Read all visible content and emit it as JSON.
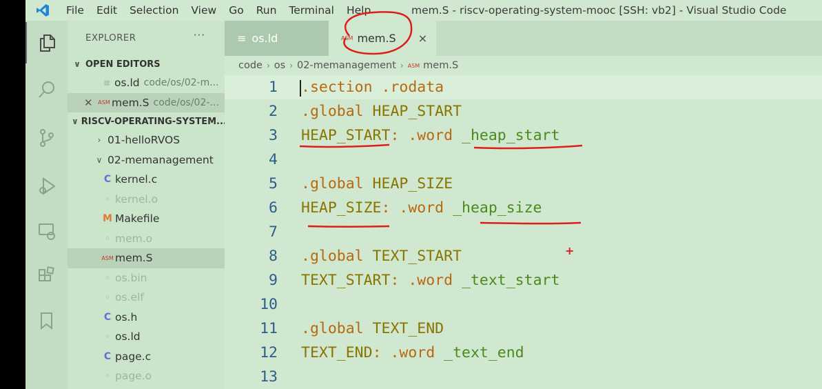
{
  "titlebar": {
    "menu": [
      "File",
      "Edit",
      "Selection",
      "View",
      "Go",
      "Run",
      "Terminal",
      "Help"
    ],
    "window_title": "mem.S - riscv-operating-system-mooc [SSH: vb2] - Visual Studio Code"
  },
  "activitybar": {
    "icons": [
      "explorer-icon",
      "search-icon",
      "source-control-icon",
      "run-debug-icon",
      "remote-explorer-icon",
      "extensions-icon",
      "bookmarks-icon"
    ]
  },
  "sidebar": {
    "title": "EXPLORER",
    "more": "···",
    "open_editors": {
      "label": "OPEN EDITORS",
      "items": [
        {
          "name": "os.ld",
          "path": "code/os/02-m..."
        },
        {
          "name": "mem.S",
          "path": "code/os/02-..."
        }
      ]
    },
    "workspace": {
      "label": "RISCV-OPERATING-SYSTEM...",
      "folders": [
        "01-helloRVOS",
        "02-memanagement"
      ],
      "files": [
        {
          "name": "kernel.c",
          "icon": "C"
        },
        {
          "name": "kernel.o",
          "icon": ""
        },
        {
          "name": "Makefile",
          "icon": "M"
        },
        {
          "name": "mem.o",
          "icon": ""
        },
        {
          "name": "mem.S",
          "icon": "ASM"
        },
        {
          "name": "os.bin",
          "icon": ""
        },
        {
          "name": "os.elf",
          "icon": ""
        },
        {
          "name": "os.h",
          "icon": "C"
        },
        {
          "name": "os.ld",
          "icon": ""
        },
        {
          "name": "page.c",
          "icon": "C"
        },
        {
          "name": "page.o",
          "icon": ""
        }
      ]
    }
  },
  "editor": {
    "tabs": [
      {
        "label": "os.ld",
        "icon": "≡"
      },
      {
        "label": "mem.S",
        "icon": "ASM",
        "close": "×"
      }
    ],
    "breadcrumb": [
      "code",
      "os",
      "02-memanagement",
      "mem.S"
    ],
    "breadcrumb_icon": "ASM",
    "lines": [
      {
        "n": "1",
        "a": ".section",
        "b": " .rodata",
        "c": ""
      },
      {
        "n": "2",
        "a": ".global",
        "b": " HEAP_START",
        "c": ""
      },
      {
        "n": "3",
        "a": "HEAP_START",
        "b": ": .word ",
        "c": "_heap_start"
      },
      {
        "n": "4",
        "a": "",
        "b": "",
        "c": ""
      },
      {
        "n": "5",
        "a": ".global",
        "b": " HEAP_SIZE",
        "c": ""
      },
      {
        "n": "6",
        "a": "HEAP_SIZE",
        "b": ": .word ",
        "c": "_heap_size"
      },
      {
        "n": "7",
        "a": "",
        "b": "",
        "c": ""
      },
      {
        "n": "8",
        "a": ".global",
        "b": " TEXT_START",
        "c": ""
      },
      {
        "n": "9",
        "a": "TEXT_START",
        "b": ": .word ",
        "c": "_text_start"
      },
      {
        "n": "10",
        "a": "",
        "b": "",
        "c": ""
      },
      {
        "n": "11",
        "a": ".global",
        "b": " TEXT_END",
        "c": ""
      },
      {
        "n": "12",
        "a": "TEXT_END",
        "b": ": .word ",
        "c": "_text_end"
      },
      {
        "n": "13",
        "a": "",
        "b": "",
        "c": ""
      }
    ],
    "annotation_plus": "+"
  }
}
